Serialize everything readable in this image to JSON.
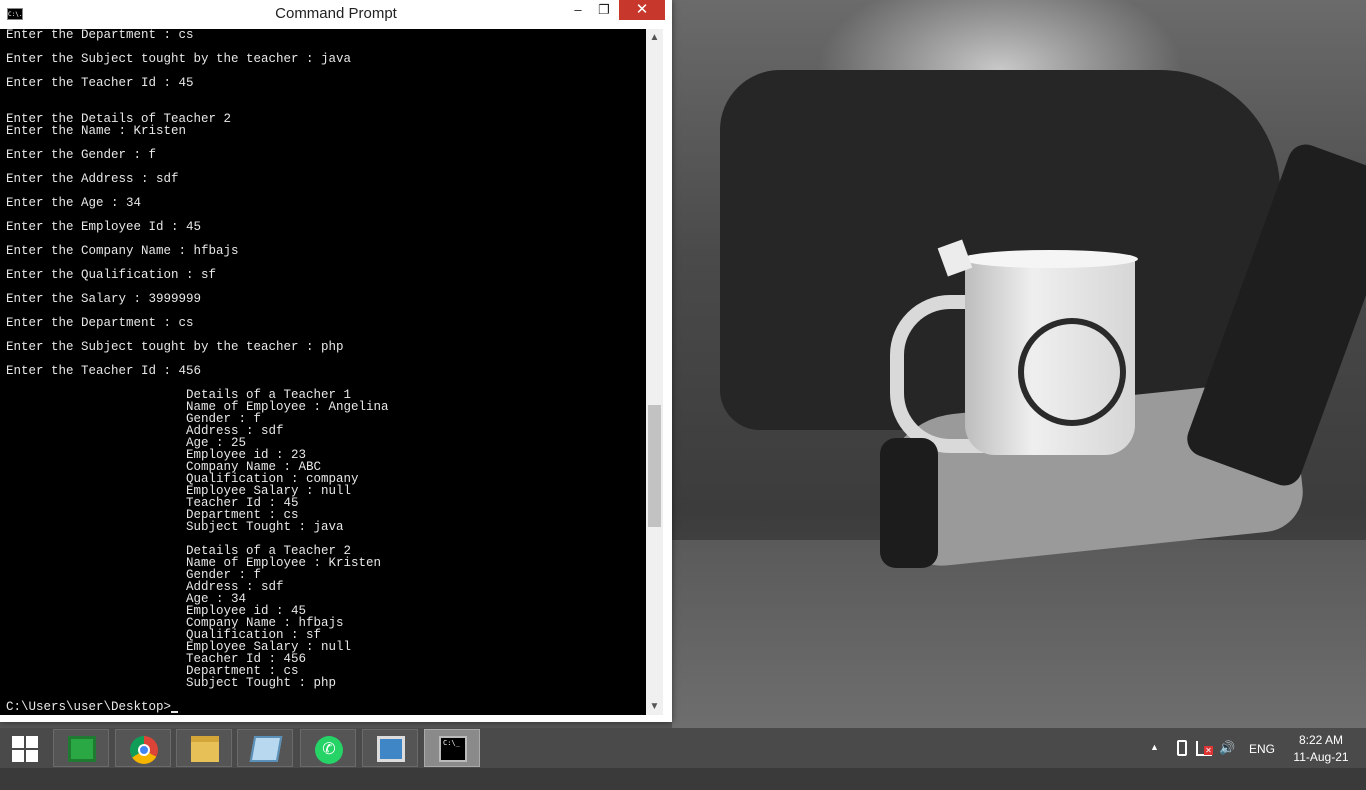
{
  "window": {
    "title": "Command Prompt",
    "icon_label": "C:\\."
  },
  "controls": {
    "minimize": "–",
    "maximize": "❐",
    "close": "✕"
  },
  "console": {
    "lines": [
      "Enter the Department : cs",
      "",
      "Enter the Subject tought by the teacher : java",
      "",
      "Enter the Teacher Id : 45",
      "",
      "",
      "Enter the Details of Teacher 2",
      "Enter the Name : Kristen",
      "",
      "Enter the Gender : f",
      "",
      "Enter the Address : sdf",
      "",
      "Enter the Age : 34",
      "",
      "Enter the Employee Id : 45",
      "",
      "Enter the Company Name : hfbajs",
      "",
      "Enter the Qualification : sf",
      "",
      "Enter the Salary : 3999999",
      "",
      "Enter the Department : cs",
      "",
      "Enter the Subject tought by the teacher : php",
      "",
      "Enter the Teacher Id : 456",
      "",
      "                        Details of a Teacher 1",
      "                        Name of Employee : Angelina",
      "                        Gender : f",
      "                        Address : sdf",
      "                        Age : 25",
      "                        Employee id : 23",
      "                        Company Name : ABC",
      "                        Qualification : company",
      "                        Employee Salary : null",
      "                        Teacher Id : 45",
      "                        Department : cs",
      "                        Subject Tought : java",
      "",
      "                        Details of a Teacher 2",
      "                        Name of Employee : Kristen",
      "                        Gender : f",
      "                        Address : sdf",
      "                        Age : 34",
      "                        Employee id : 45",
      "                        Company Name : hfbajs",
      "                        Qualification : sf",
      "                        Employee Salary : null",
      "                        Teacher Id : 456",
      "                        Department : cs",
      "                        Subject Tought : php",
      ""
    ],
    "prompt": "C:\\Users\\user\\Desktop>"
  },
  "scrollbar": {
    "up_arrow": "▲",
    "down_arrow": "▼"
  },
  "taskbar": {
    "apps": [
      {
        "name": "store-app",
        "icon": "store-icon"
      },
      {
        "name": "chrome-app",
        "icon": "chrome-icon"
      },
      {
        "name": "file-explorer-app",
        "icon": "folder-icon"
      },
      {
        "name": "notepad-app",
        "icon": "notepad-icon"
      },
      {
        "name": "whatsapp-app",
        "icon": "whatsapp-icon"
      },
      {
        "name": "photos-app",
        "icon": "photos-icon"
      },
      {
        "name": "command-prompt-app",
        "icon": "cmd-icon",
        "active": true
      }
    ],
    "whatsapp_glyph": "✆",
    "cmd_label": "C:\\_",
    "tray": {
      "up_arrow": "▲",
      "net_x": "✕",
      "volume": "🔊",
      "language": "ENG",
      "time": "8:22 AM",
      "date": "11-Aug-21"
    }
  }
}
